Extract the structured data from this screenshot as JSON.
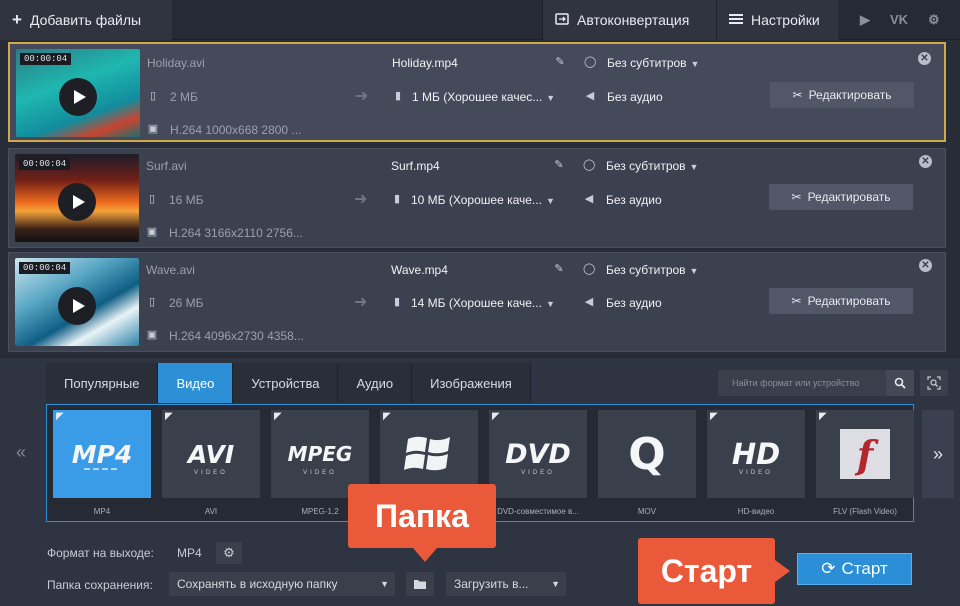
{
  "toolbar": {
    "add_files": "Добавить файлы",
    "autoconvert": "Автоконвертация",
    "settings": "Настройки",
    "social": [
      "▶",
      "VK",
      "⚙"
    ]
  },
  "files": [
    {
      "duration": "00:00:04",
      "src_name": "Holiday.avi",
      "src_size": "2 МБ",
      "codec": "H.264 1000x668 2800 ...",
      "out_name": "Holiday.mp4",
      "out_size": "1 МБ (Хорошее качес...",
      "subtitles": "Без субтитров",
      "audio": "Без аудио",
      "edit": "Редактировать"
    },
    {
      "duration": "00:00:04",
      "src_name": "Surf.avi",
      "src_size": "16 МБ",
      "codec": "H.264 3166x2110 2756...",
      "out_name": "Surf.mp4",
      "out_size": "10 МБ (Хорошее каче...",
      "subtitles": "Без субтитров",
      "audio": "Без аудио",
      "edit": "Редактировать"
    },
    {
      "duration": "00:00:04",
      "src_name": "Wave.avi",
      "src_size": "26 МБ",
      "codec": "H.264 4096x2730 4358...",
      "out_name": "Wave.mp4",
      "out_size": "14 МБ (Хорошее каче...",
      "subtitles": "Без субтитров",
      "audio": "Без аудио",
      "edit": "Редактировать"
    }
  ],
  "tabs": [
    "Популярные",
    "Видео",
    "Устройства",
    "Аудио",
    "Изображения"
  ],
  "active_tab": "Видео",
  "search_placeholder": "Найти формат или устройство",
  "formats": [
    {
      "logo": "MP4",
      "sub": "",
      "label": "MP4"
    },
    {
      "logo": "AVI",
      "sub": "VIDEO",
      "label": "AVI"
    },
    {
      "logo": "MPEG",
      "sub": "VIDEO",
      "label": "MPEG-1,2"
    },
    {
      "logo": "",
      "sub": "",
      "label": ""
    },
    {
      "logo": "DVD",
      "sub": "VIDEO",
      "label": "DVD-совместимое в..."
    },
    {
      "logo": "Q",
      "sub": "",
      "label": "MOV"
    },
    {
      "logo": "HD",
      "sub": "VIDEO",
      "label": "HD-видео"
    },
    {
      "logo": "f",
      "sub": "",
      "label": "FLV (Flash Video)"
    }
  ],
  "nav": {
    "prev": "«",
    "next": "»"
  },
  "output": {
    "format_label": "Формат на выходе:",
    "format_value": "MP4",
    "folder_label": "Папка сохранения:",
    "folder_value": "Сохранять в исходную папку",
    "upload": "Загрузить в...",
    "start": "Старт"
  },
  "callouts": {
    "folder": "Папка",
    "start": "Старт"
  },
  "colors": {
    "accent": "#2d8fd6",
    "callout": "#ea5a3a",
    "selected_border": "#cfa84a"
  }
}
